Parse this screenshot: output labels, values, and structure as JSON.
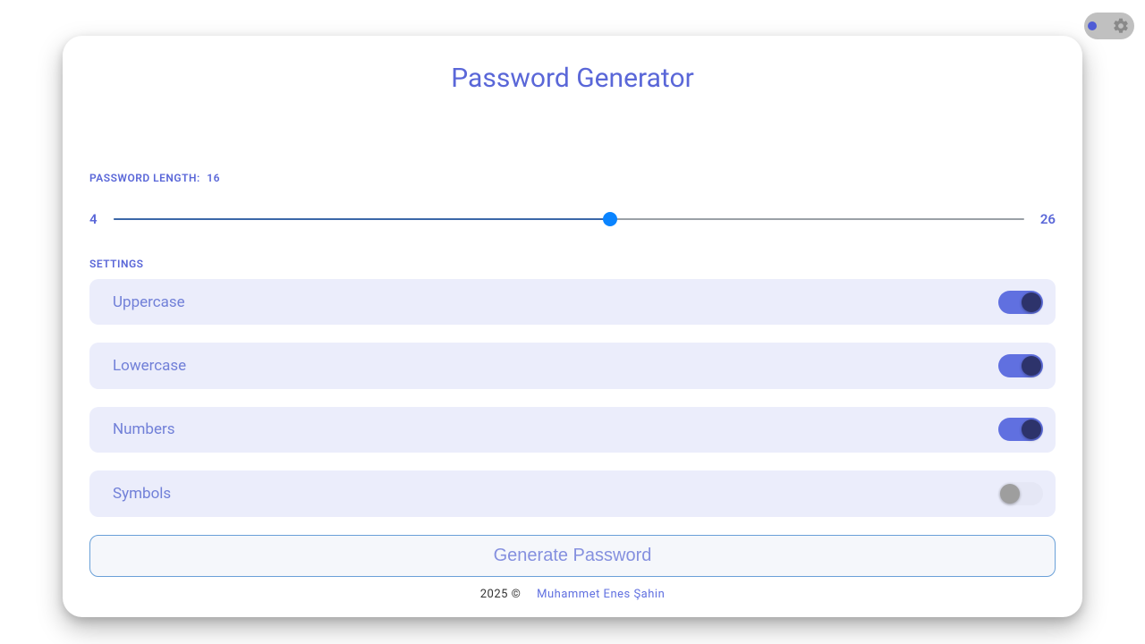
{
  "title": "Password Generator",
  "length": {
    "label": "PASSWORD LENGTH:",
    "value": "16",
    "min": "4",
    "max": "26"
  },
  "settings_label": "SETTINGS",
  "settings": {
    "uppercase": {
      "label": "Uppercase",
      "enabled": true
    },
    "lowercase": {
      "label": "Lowercase",
      "enabled": true
    },
    "numbers": {
      "label": "Numbers",
      "enabled": true
    },
    "symbols": {
      "label": "Symbols",
      "enabled": false
    }
  },
  "generate_label": "Generate Password",
  "footer": {
    "copyright": "2025 ©",
    "author": "Muhammet Enes Şahin"
  }
}
